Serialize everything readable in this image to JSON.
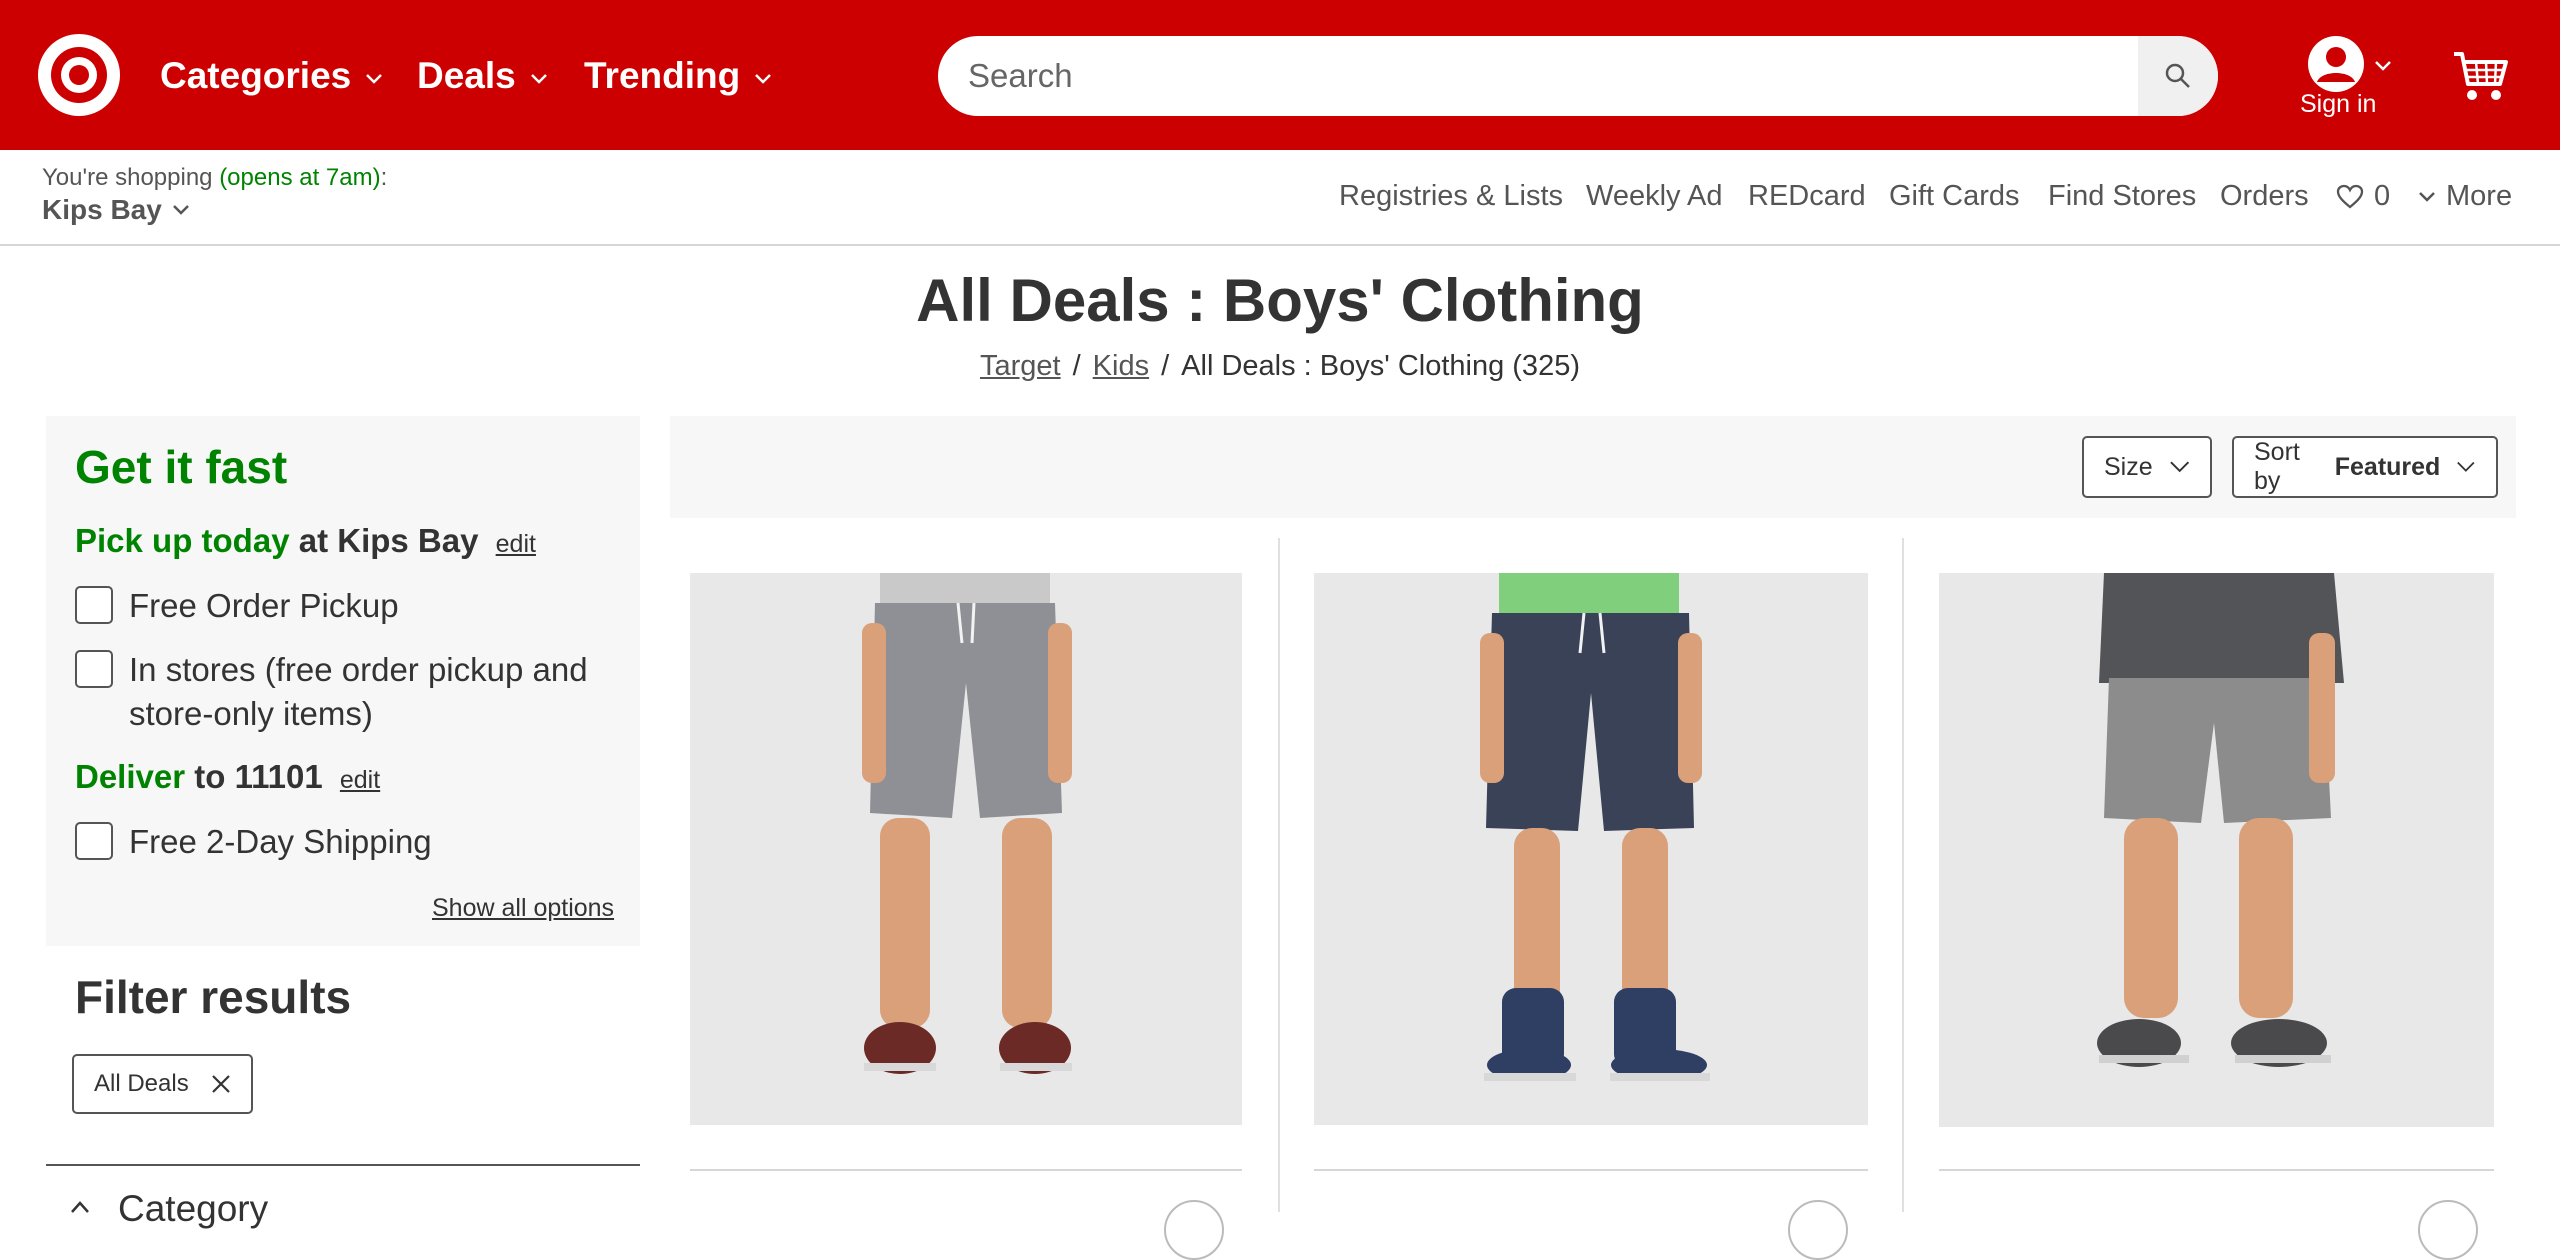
{
  "header": {
    "nav": [
      {
        "label": "Categories"
      },
      {
        "label": "Deals"
      },
      {
        "label": "Trending"
      }
    ],
    "search": {
      "placeholder": "Search"
    },
    "account": {
      "label": "Sign in"
    },
    "brand_color": "#cc0000"
  },
  "subheader": {
    "shopping_prefix": "You're shopping",
    "opens_text": "(opens at 7am)",
    "colon": ":",
    "store_name": "Kips Bay",
    "links": [
      "Registries & Lists",
      "Weekly Ad",
      "REDcard",
      "Gift Cards",
      "Find Stores",
      "Orders"
    ],
    "favorites_count": "0",
    "more_label": "More"
  },
  "page": {
    "title": "All Deals : Boys' Clothing",
    "breadcrumb": {
      "home": "Target",
      "parent": "Kids",
      "sep": "/",
      "current": "All Deals : Boys' Clothing (325)"
    }
  },
  "fast_panel": {
    "title": "Get it fast",
    "pickup_green": "Pick up today",
    "pickup_rest": "at Kips Bay",
    "edit_label": "edit",
    "options": [
      {
        "label": "Free Order Pickup",
        "checked": false
      },
      {
        "label": "In stores (free order pickup and store-only items)",
        "checked": false
      }
    ],
    "deliver_green": "Deliver",
    "deliver_rest": "to 11101",
    "shipping_option": {
      "label": "Free 2-Day Shipping",
      "checked": false
    },
    "show_all": "Show all options",
    "accent_color": "#008300"
  },
  "filters": {
    "title": "Filter results",
    "active_chip": "All Deals",
    "category_label": "Category"
  },
  "results_toolbar": {
    "size_label": "Size",
    "sort_prefix": "Sort by",
    "sort_value": "Featured"
  },
  "products": [
    {
      "image": "gray-shorts",
      "shirt": "#c9c9c9",
      "shorts": "#8f9095",
      "shoes": "#6b2a26"
    },
    {
      "image": "navy-shorts",
      "shirt": "#7fcf7d",
      "shorts": "#3a4258",
      "shoes": "#2e3f63"
    },
    {
      "image": "heather-gray-shorts",
      "shirt": "#525458",
      "shorts": "#8c8c8c",
      "shoes": "#4a4a4c"
    }
  ]
}
